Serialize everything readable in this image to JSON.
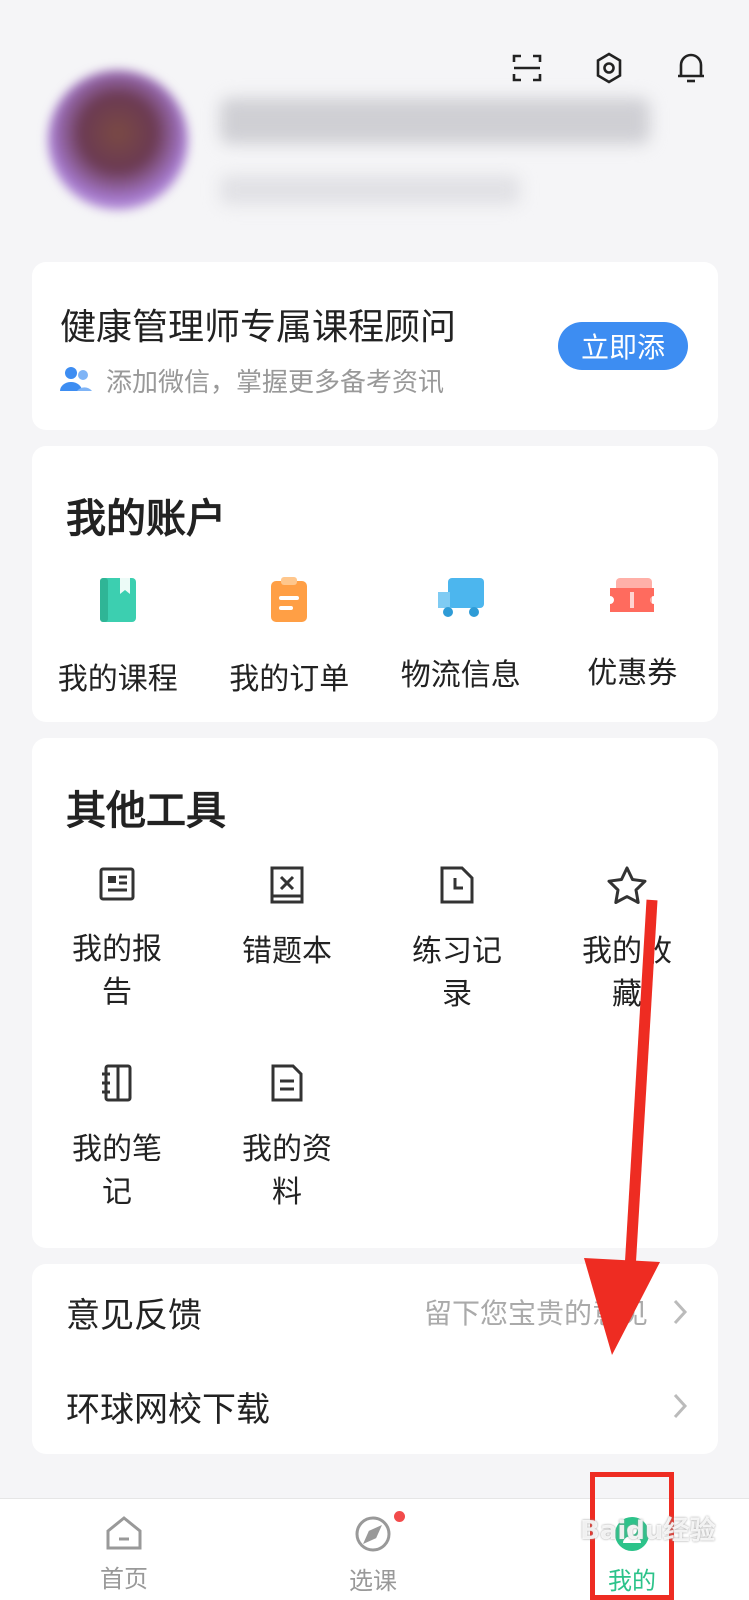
{
  "header": {
    "icons": [
      "scan-icon",
      "settings-icon",
      "bell-icon"
    ]
  },
  "advisor": {
    "title": "健康管理师专属课程顾问",
    "subtitle": "添加微信，掌握更多备考资讯",
    "button": "立即添"
  },
  "account": {
    "title": "我的账户",
    "items": [
      {
        "label": "我的课程",
        "icon": "course-book-icon",
        "color": "#3ccfb0"
      },
      {
        "label": "我的订单",
        "icon": "order-clipboard-icon",
        "color": "#ff9f45"
      },
      {
        "label": "物流信息",
        "icon": "delivery-truck-icon",
        "color": "#4cb6ee"
      },
      {
        "label": "优惠券",
        "icon": "coupon-ticket-icon",
        "color": "#ff6b5e"
      }
    ]
  },
  "tools": {
    "title": "其他工具",
    "items": [
      {
        "label": "我的报告",
        "icon": "report-icon"
      },
      {
        "label": "错题本",
        "icon": "wrong-questions-icon"
      },
      {
        "label": "练习记录",
        "icon": "practice-record-icon"
      },
      {
        "label": "我的收藏",
        "icon": "star-icon"
      },
      {
        "label": "我的笔记",
        "icon": "notebook-icon"
      },
      {
        "label": "我的资料",
        "icon": "document-icon"
      }
    ]
  },
  "menu": {
    "feedback": {
      "label": "意见反馈",
      "hint": "留下您宝贵的意见"
    },
    "download": {
      "label": "环球网校下载"
    }
  },
  "nav": {
    "items": [
      {
        "label": "首页",
        "icon": "home-icon"
      },
      {
        "label": "选课",
        "icon": "compass-icon"
      },
      {
        "label": "我的",
        "icon": "profile-icon"
      }
    ]
  },
  "watermark": "Baidu经验",
  "colors": {
    "accent": "#3d8df2",
    "annotation": "#ee2c22"
  }
}
